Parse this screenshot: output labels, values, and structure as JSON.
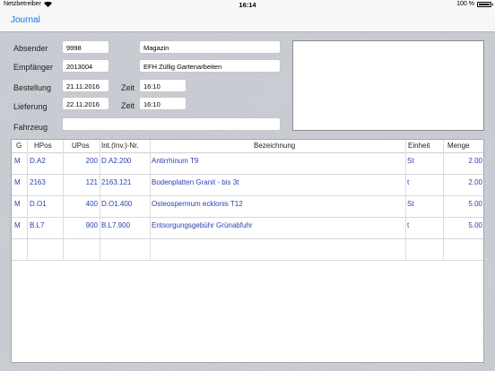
{
  "status": {
    "carrier": "Netzbetreiber",
    "time": "16:14",
    "battery": "100 %"
  },
  "nav": {
    "back_label": "Journal"
  },
  "form": {
    "absender": {
      "label": "Absender",
      "id": "9998",
      "name": "Magazin"
    },
    "empfaenger": {
      "label": "Empfänger",
      "id": "2013004",
      "name": "EFH Züllig Gartenarbeiten"
    },
    "bestellung": {
      "label": "Bestellung",
      "date": "21.11.2016",
      "zeit_label": "Zeit",
      "time": "16:10"
    },
    "lieferung": {
      "label": "Lieferung",
      "date": "22.11.2016",
      "zeit_label": "Zeit",
      "time": "16:10"
    },
    "fahrzeug": {
      "label": "Fahrzeug",
      "value": ""
    }
  },
  "table": {
    "headers": [
      "G",
      "HPos",
      "UPos",
      "Int.(Inv.)-Nr.",
      "Bezeichnung",
      "Einheit",
      "Menge"
    ],
    "rows": [
      [
        "M",
        "D.A2",
        "200",
        "D.A2.200",
        "Antirrhinum T9",
        "St",
        "2.00"
      ],
      [
        "M",
        "2163",
        "121",
        "2163.121",
        "Bodenplatten Granit - bis 3t",
        "t",
        "2.00"
      ],
      [
        "M",
        "D.O1",
        "400",
        "D.O1.400",
        "Osteospermum ecklonis T12",
        "St",
        "5.00"
      ],
      [
        "M",
        "B.L7",
        "900",
        "B.L7.900",
        "Entsorgungsgebühr Grünabfuhr",
        "t",
        "5.00"
      ]
    ]
  }
}
